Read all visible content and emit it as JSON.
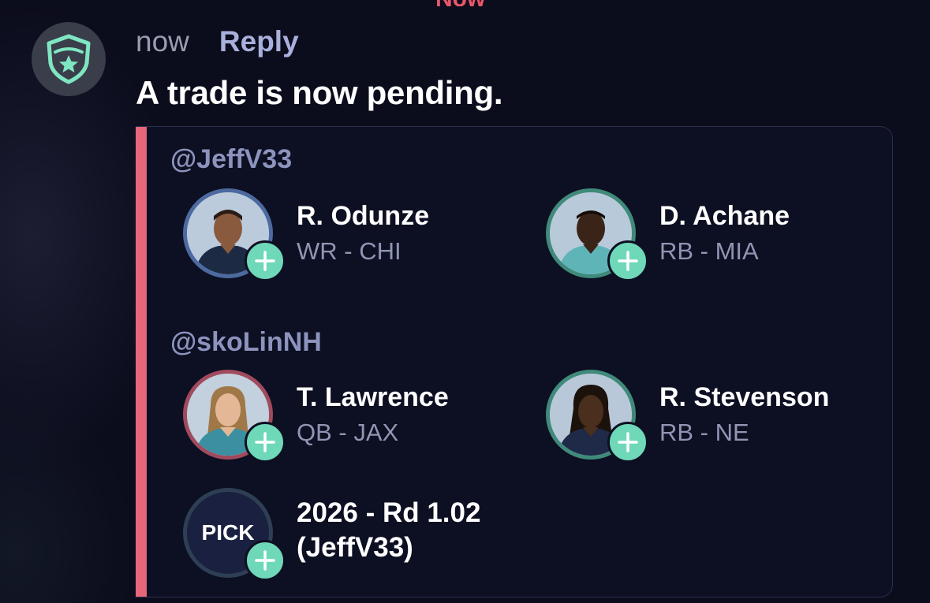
{
  "header_cutoff": "Now",
  "message": {
    "timestamp": "now",
    "reply_label": "Reply",
    "text": "A trade is now pending.",
    "avatar_icon": "shield-star-icon"
  },
  "trade": {
    "accent_color": "#e6667a",
    "sides": [
      {
        "handle": "@JeffV33",
        "assets": [
          {
            "name": "R. Odunze",
            "position": "WR - CHI",
            "ring_color": "#4c6aa0",
            "icon": "player-photo"
          },
          {
            "name": "D. Achane",
            "position": "RB - MIA",
            "ring_color": "#3f8a7a",
            "icon": "player-photo"
          }
        ]
      },
      {
        "handle": "@skoLinNH",
        "assets": [
          {
            "name": "T. Lawrence",
            "position": "QB - JAX",
            "ring_color": "#a04a5e",
            "icon": "player-photo"
          },
          {
            "name": "R. Stevenson",
            "position": "RB - NE",
            "ring_color": "#3f8a7a",
            "icon": "player-photo"
          }
        ],
        "pick": {
          "badge": "PICK",
          "line1": "2026 - Rd 1.02",
          "line2": "(JeffV33)"
        }
      }
    ]
  }
}
